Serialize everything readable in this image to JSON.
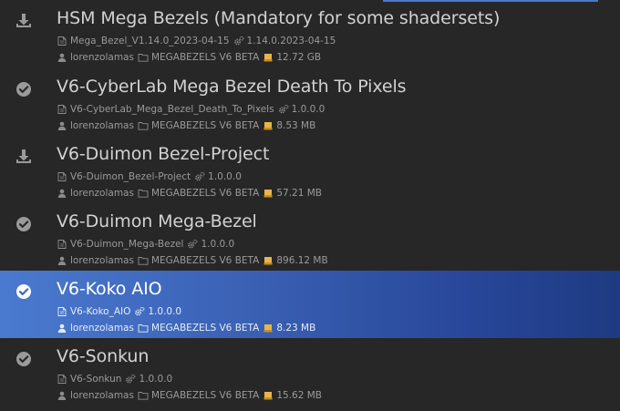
{
  "packages": [
    {
      "status": "download-icon",
      "title": "HSM Mega Bezels (Mandatory for some shadersets)",
      "filename": "Mega_Bezel_V1.14.0_2023-04-15",
      "version": "1.14.0.2023-04-15",
      "author": "lorenzolamas",
      "folder": "MEGABEZELS V6 BETA",
      "size": "12.72 GB",
      "selected": false
    },
    {
      "status": "check-circle-icon",
      "title": "V6-CyberLab Mega Bezel Death To Pixels",
      "filename": "V6-CyberLab_Mega_Bezel_Death_To_Pixels",
      "version": "1.0.0.0",
      "author": "lorenzolamas",
      "folder": "MEGABEZELS V6 BETA",
      "size": "8.53 MB",
      "selected": false
    },
    {
      "status": "download-icon",
      "title": "V6-Duimon Bezel-Project",
      "filename": "V6-Duimon_Bezel-Project",
      "version": "1.0.0.0",
      "author": "lorenzolamas",
      "folder": "MEGABEZELS V6 BETA",
      "size": "57.21 MB",
      "selected": false
    },
    {
      "status": "check-circle-icon",
      "title": "V6-Duimon Mega-Bezel",
      "filename": "V6-Duimon_Mega-Bezel",
      "version": "1.0.0.0",
      "author": "lorenzolamas",
      "folder": "MEGABEZELS V6 BETA",
      "size": "896.12 MB",
      "selected": false
    },
    {
      "status": "check-circle-icon",
      "title": "V6-Koko AIO",
      "filename": "V6-Koko_AIO",
      "version": "1.0.0.0",
      "author": "lorenzolamas",
      "folder": "MEGABEZELS V6 BETA",
      "size": "8.23 MB",
      "selected": true
    },
    {
      "status": "check-circle-icon",
      "title": "V6-Sonkun",
      "filename": "V6-Sonkun",
      "version": "1.0.0.0",
      "author": "lorenzolamas",
      "folder": "MEGABEZELS V6 BETA",
      "size": "15.62 MB",
      "selected": false
    }
  ],
  "colors": {
    "background": "#272727",
    "selection_start": "#4a7ad0",
    "selection_end": "#1e3a82",
    "drive_icon": "#e8b54a"
  }
}
